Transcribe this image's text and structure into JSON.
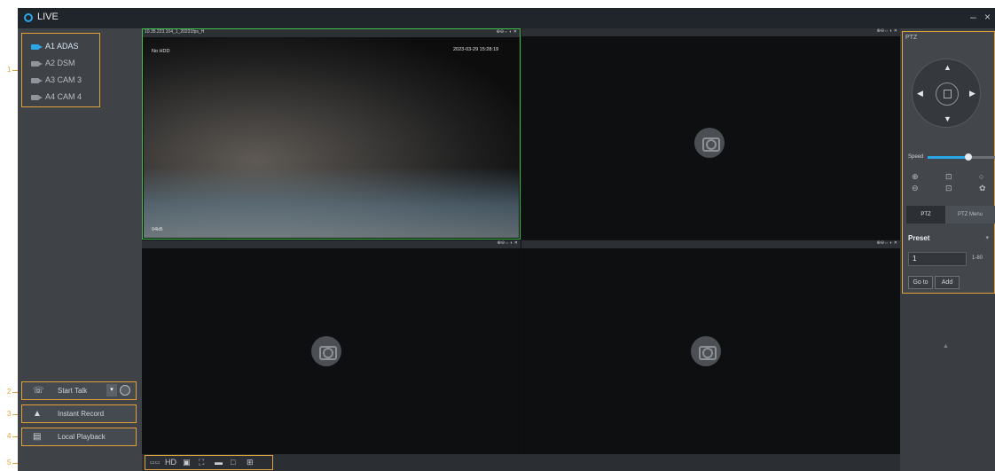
{
  "app": {
    "title": "LIVE",
    "window_controls": "– ×"
  },
  "channels": [
    {
      "label": "A1 ADAS",
      "active": true
    },
    {
      "label": "A2 DSM",
      "active": false
    },
    {
      "label": "A3 CAM 3",
      "active": false
    },
    {
      "label": "A4 CAM 4",
      "active": false
    }
  ],
  "actions": {
    "start_talk": "Start Talk",
    "instant_record": "Instant Record",
    "local_playback": "Local Playback"
  },
  "callouts": [
    "1",
    "2",
    "3",
    "4",
    "5"
  ],
  "video": {
    "cell1_name": "10.35.223.104_1_20231fps_H",
    "cell1_nohdd": "No HDD",
    "cell1_datetime": "2023-03-29 15:28:19",
    "cell1_bottom_left": "04kB",
    "cell_controls": "⊕⊖⇔ ◐ ✕"
  },
  "toolbar": {
    "hd": "HD"
  },
  "ptz": {
    "header": "PTZ",
    "speed_label": "Speed",
    "speed_value": 0.6,
    "tab_ptz": "PTZ",
    "tab_menu": "PTZ Menu",
    "preset_label": "Preset",
    "preset_value": "1",
    "preset_range": "1-80",
    "goto": "Go to",
    "add": "Add"
  },
  "colors": {
    "accent": "#2aa7e6",
    "callout": "#e0a13a",
    "selected_border": "#3fbf4b"
  }
}
